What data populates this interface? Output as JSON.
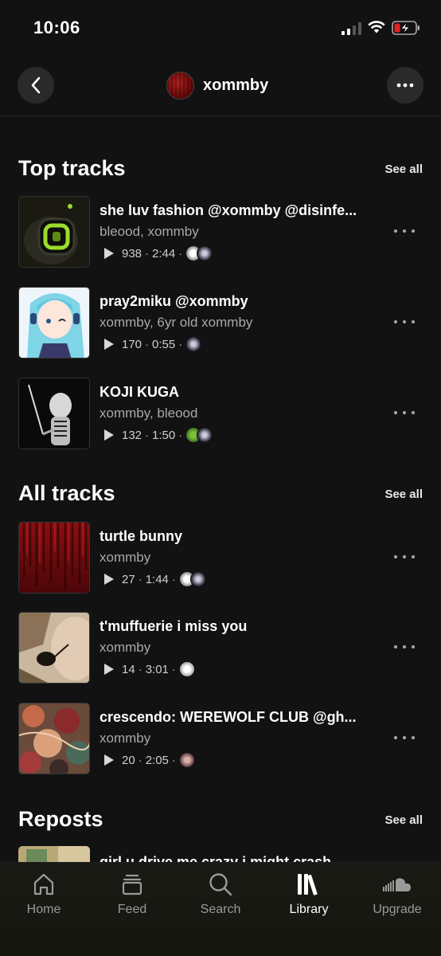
{
  "status_bar": {
    "time": "10:06"
  },
  "header": {
    "title": "xommby"
  },
  "sections": [
    {
      "title": "Top tracks",
      "see_all": "See all",
      "tracks": [
        {
          "title": "she luv fashion @xommby @disinfe...",
          "artists": "bleood, xommby",
          "plays": "938",
          "duration": "2:44"
        },
        {
          "title": "pray2miku @xommby",
          "artists": "xommby, 6yr old xommby",
          "plays": "170",
          "duration": "0:55"
        },
        {
          "title": "KOJI KUGA",
          "artists": "xommby, bleood",
          "plays": "132",
          "duration": "1:50"
        }
      ]
    },
    {
      "title": "All tracks",
      "see_all": "See all",
      "tracks": [
        {
          "title": "turtle bunny",
          "artists": "xommby",
          "plays": "27",
          "duration": "1:44"
        },
        {
          "title": "t'muffuerie i miss you",
          "artists": "xommby",
          "plays": "14",
          "duration": "3:01"
        },
        {
          "title": "crescendo: WEREWOLF CLUB @gh...",
          "artists": "xommby",
          "plays": "20",
          "duration": "2:05"
        }
      ]
    },
    {
      "title": "Reposts",
      "see_all": "See all",
      "tracks": [
        {
          "title": "girl u drive me crazy i might crash"
        }
      ]
    }
  ],
  "nav": [
    {
      "label": "Home",
      "icon": "home-icon"
    },
    {
      "label": "Feed",
      "icon": "feed-icon"
    },
    {
      "label": "Search",
      "icon": "search-icon"
    },
    {
      "label": "Library",
      "icon": "library-icon",
      "active": true
    },
    {
      "label": "Upgrade",
      "icon": "cloud-icon"
    }
  ],
  "colors": {
    "background": "#121212",
    "secondary_text": "#a8a8a8",
    "battery_low": "#e02424"
  }
}
